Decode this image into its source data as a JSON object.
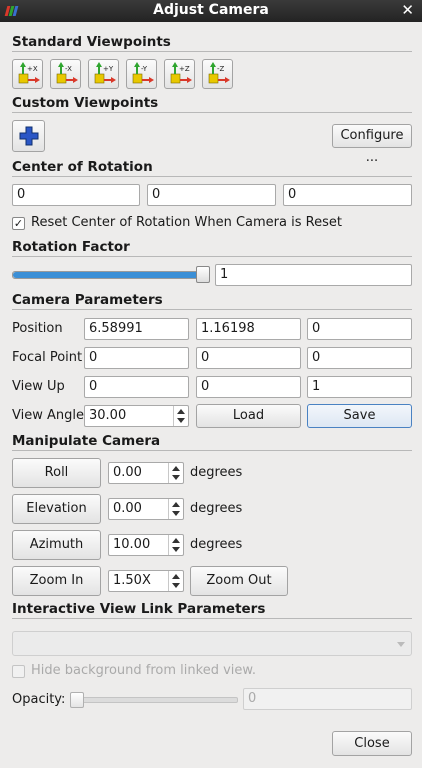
{
  "window": {
    "title": "Adjust Camera",
    "close_glyph": "✕"
  },
  "standard_viewpoints": {
    "title": "Standard Viewpoints",
    "buttons": [
      {
        "label": "+X",
        "icon": "axis-plus-x-icon"
      },
      {
        "label": "-X",
        "icon": "axis-minus-x-icon"
      },
      {
        "label": "+Y",
        "icon": "axis-plus-y-icon"
      },
      {
        "label": "-Y",
        "icon": "axis-minus-y-icon"
      },
      {
        "label": "+Z",
        "icon": "axis-plus-z-icon"
      },
      {
        "label": "-Z",
        "icon": "axis-minus-z-icon"
      }
    ]
  },
  "custom_viewpoints": {
    "title": "Custom Viewpoints",
    "add_icon": "plus-icon",
    "configure_label": "Configure ..."
  },
  "center_of_rotation": {
    "title": "Center of Rotation",
    "values": [
      "0",
      "0",
      "0"
    ],
    "reset_checked": true,
    "reset_label": "Reset Center of Rotation When Camera is Reset"
  },
  "rotation_factor": {
    "title": "Rotation Factor",
    "slider_fraction": 1.0,
    "value": "1"
  },
  "camera_parameters": {
    "title": "Camera Parameters",
    "position": {
      "label": "Position",
      "values": [
        "6.58991",
        "1.16198",
        "0"
      ]
    },
    "focal_point": {
      "label": "Focal Point",
      "values": [
        "0",
        "0",
        "0"
      ]
    },
    "view_up": {
      "label": "View Up",
      "values": [
        "0",
        "0",
        "1"
      ]
    },
    "view_angle": {
      "label": "View Angle",
      "value": "30.00"
    },
    "load_label": "Load",
    "save_label": "Save"
  },
  "manipulate_camera": {
    "title": "Manipulate Camera",
    "roll": {
      "label": "Roll",
      "value": "0.00",
      "unit": "degrees"
    },
    "elevation": {
      "label": "Elevation",
      "value": "0.00",
      "unit": "degrees"
    },
    "azimuth": {
      "label": "Azimuth",
      "value": "10.00",
      "unit": "degrees"
    },
    "zoom_in_label": "Zoom In",
    "zoom_value": "1.50X",
    "zoom_out_label": "Zoom Out"
  },
  "interactive_view_link": {
    "title": "Interactive View Link Parameters",
    "combo_value": "",
    "hide_background_checked": false,
    "hide_background_label": "Hide background from linked view.",
    "opacity_label": "Opacity:",
    "opacity_slider_fraction": 0.0,
    "opacity_value": "0"
  },
  "close_label": "Close",
  "colors": {
    "titlebar": "#2b2b2b",
    "accent": "#4a82c2",
    "axis_yellow": "#e8c800",
    "axis_green": "#2fa52f",
    "axis_red": "#d9382a"
  }
}
